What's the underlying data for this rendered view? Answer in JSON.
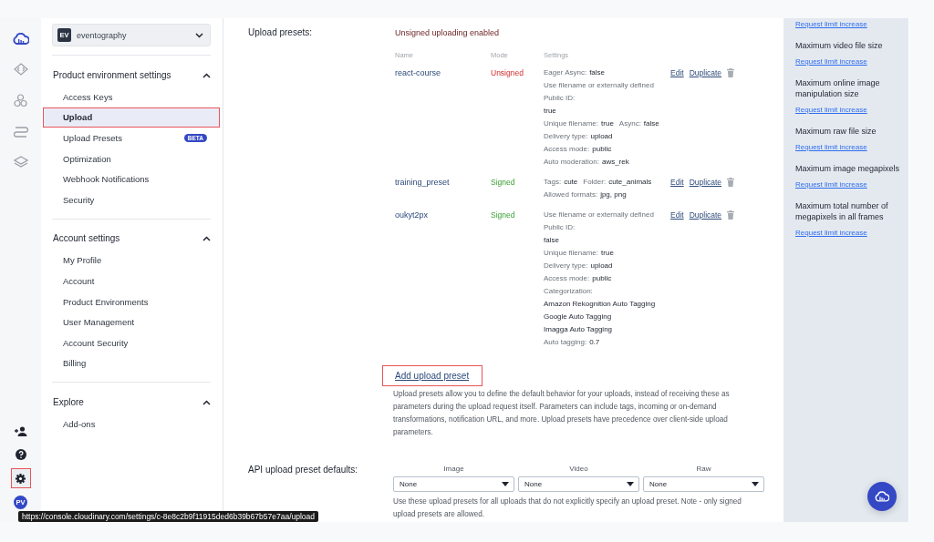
{
  "rail": {
    "top": [
      {
        "kind": "logo"
      },
      {
        "kind": "code"
      },
      {
        "kind": "nodes"
      },
      {
        "kind": "route"
      },
      {
        "kind": "layers"
      }
    ],
    "bottom": [
      {
        "kind": "add-user",
        "highlighted": false
      },
      {
        "kind": "help",
        "highlighted": false
      },
      {
        "kind": "settings",
        "highlighted": true
      }
    ],
    "avatar": "PV"
  },
  "environment": {
    "badge": "EV",
    "name": "eventography"
  },
  "sidebar": [
    {
      "title": "Product environment settings",
      "expanded": true,
      "items": [
        {
          "label": "Access Keys",
          "selected": false,
          "highlighted": false
        },
        {
          "label": "Upload",
          "selected": true,
          "highlighted": true
        },
        {
          "label": "Upload Presets",
          "selected": false,
          "highlighted": false,
          "badge": "BETA"
        },
        {
          "label": "Optimization",
          "selected": false,
          "highlighted": false
        },
        {
          "label": "Webhook Notifications",
          "selected": false,
          "highlighted": false
        },
        {
          "label": "Security",
          "selected": false,
          "highlighted": false
        }
      ]
    },
    {
      "title": "Account settings",
      "expanded": true,
      "items": [
        {
          "label": "My Profile",
          "selected": false,
          "highlighted": false
        },
        {
          "label": "Account",
          "selected": false,
          "highlighted": false
        },
        {
          "label": "Product Environments",
          "selected": false,
          "highlighted": false
        },
        {
          "label": "User Management",
          "selected": false,
          "highlighted": false
        },
        {
          "label": "Account Security",
          "selected": false,
          "highlighted": false
        },
        {
          "label": "Billing",
          "selected": false,
          "highlighted": false
        }
      ]
    },
    {
      "title": "Explore",
      "expanded": true,
      "items": [
        {
          "label": "Add-ons",
          "selected": false,
          "highlighted": false
        }
      ]
    }
  ],
  "upload_presets": {
    "label": "Upload presets:",
    "status": "Unsigned uploading enabled",
    "columns": [
      "Name",
      "Mode",
      "Settings"
    ],
    "rows": [
      {
        "name": "react-course",
        "mode": "Unsigned",
        "signed": false,
        "edit": "Edit",
        "duplicate": "Duplicate",
        "settings": [
          [
            {
              "kind": "label",
              "text": "Eager Async:"
            },
            {
              "kind": "value",
              "text": "false"
            }
          ],
          [
            {
              "kind": "label",
              "text": "Use filename or externally defined"
            }
          ],
          [
            {
              "kind": "label",
              "text": "Public ID:"
            }
          ],
          [
            {
              "kind": "value",
              "text": "true"
            }
          ],
          [
            {
              "kind": "label",
              "text": "Unique filename:"
            },
            {
              "kind": "value",
              "text": "true"
            },
            {
              "kind": "label",
              "text": "Async:"
            },
            {
              "kind": "value",
              "text": "false"
            }
          ],
          [
            {
              "kind": "label",
              "text": "Delivery type:"
            },
            {
              "kind": "value",
              "text": "upload"
            }
          ],
          [
            {
              "kind": "label",
              "text": "Access mode:"
            },
            {
              "kind": "value",
              "text": "public"
            }
          ],
          [
            {
              "kind": "label",
              "text": "Auto moderation:"
            },
            {
              "kind": "value",
              "text": "aws_rek"
            }
          ]
        ]
      },
      {
        "name": "training_preset",
        "mode": "Signed",
        "signed": true,
        "edit": "Edit",
        "duplicate": "Duplicate",
        "settings": [
          [
            {
              "kind": "label",
              "text": "Tags:"
            },
            {
              "kind": "value",
              "text": "cute"
            },
            {
              "kind": "label",
              "text": "Folder:"
            },
            {
              "kind": "value",
              "text": "cute_animals"
            }
          ],
          [
            {
              "kind": "label",
              "text": "Allowed formats:"
            },
            {
              "kind": "value",
              "text": "jpg, png"
            }
          ]
        ]
      },
      {
        "name": "oukyt2px",
        "mode": "Signed",
        "signed": true,
        "edit": "Edit",
        "duplicate": "Duplicate",
        "settings": [
          [
            {
              "kind": "label",
              "text": "Use filename or externally defined"
            }
          ],
          [
            {
              "kind": "label",
              "text": "Public ID:"
            }
          ],
          [
            {
              "kind": "value",
              "text": "false"
            }
          ],
          [
            {
              "kind": "label",
              "text": "Unique filename:"
            },
            {
              "kind": "value",
              "text": "true"
            }
          ],
          [
            {
              "kind": "label",
              "text": "Delivery type:"
            },
            {
              "kind": "value",
              "text": "upload"
            }
          ],
          [
            {
              "kind": "label",
              "text": "Access mode:"
            },
            {
              "kind": "value",
              "text": "public"
            }
          ],
          [
            {
              "kind": "label",
              "text": "Categorization:"
            }
          ],
          [
            {
              "kind": "value",
              "text": "Amazon Rekognition Auto Tagging"
            }
          ],
          [
            {
              "kind": "value",
              "text": "Google Auto Tagging"
            }
          ],
          [
            {
              "kind": "value",
              "text": "Imagga Auto Tagging"
            }
          ],
          [
            {
              "kind": "label",
              "text": "Auto tagging:"
            },
            {
              "kind": "value",
              "text": "0.7"
            }
          ]
        ]
      }
    ],
    "add_link": {
      "text": "Add upload preset",
      "highlighted": true
    },
    "description": "Upload presets allow you to define the default behavior for your uploads, instead of receiving these as parameters during the upload request itself. Parameters can include tags, incoming or on-demand transformations, notification URL, and more. Upload presets have precedence over client-side upload parameters."
  },
  "api_defaults": {
    "label": "API upload preset defaults:",
    "selects": [
      {
        "label": "Image",
        "value": "None"
      },
      {
        "label": "Video",
        "value": "None"
      },
      {
        "label": "Raw",
        "value": "None"
      }
    ],
    "note": "Use these upload presets for all uploads that do not explicitly specify an upload preset. Note - only signed upload presets are allowed."
  },
  "limits": [
    {
      "link": "Request limit increase"
    },
    {
      "title": "Maximum video file size",
      "link": "Request limit increase"
    },
    {
      "title": "Maximum online image manipulation size",
      "link": "Request limit increase"
    },
    {
      "title": "Maximum raw file size",
      "link": "Request limit increase"
    },
    {
      "title": "Maximum image megapixels",
      "link": "Request limit increase"
    },
    {
      "title": "Maximum total number of megapixels in all frames",
      "link": "Request limit increase"
    }
  ],
  "status_url": "https://console.cloudinary.com/settings/c-8e8c2b9f11915ded6b39b67b57e7aa/upload"
}
